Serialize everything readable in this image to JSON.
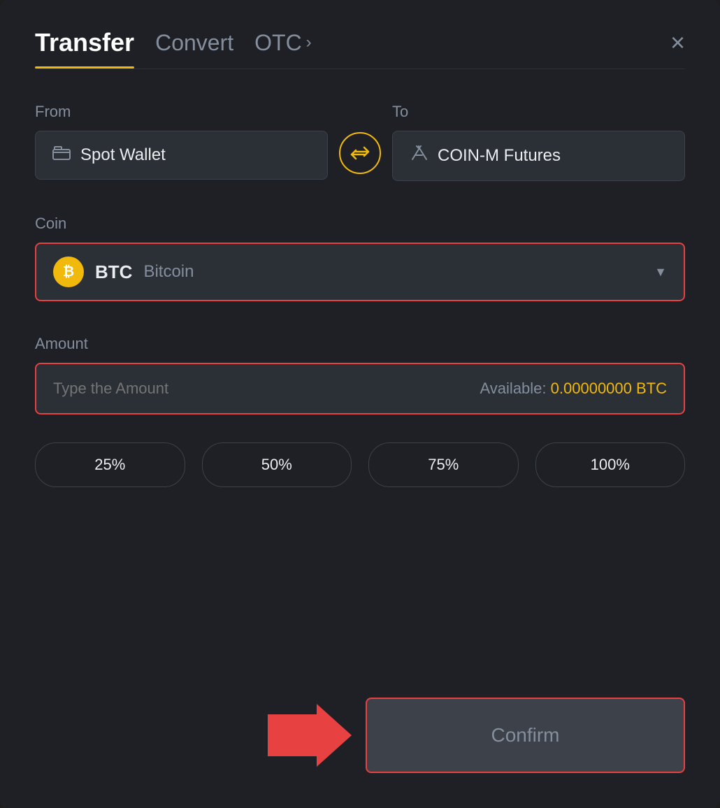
{
  "header": {
    "tab_transfer": "Transfer",
    "tab_convert": "Convert",
    "tab_otc": "OTC",
    "close_label": "×"
  },
  "from": {
    "label": "From",
    "wallet": "Spot Wallet"
  },
  "to": {
    "label": "To",
    "wallet": "COIN-M Futures"
  },
  "coin": {
    "label": "Coin",
    "symbol": "BTC",
    "name": "Bitcoin"
  },
  "amount": {
    "label": "Amount",
    "placeholder": "Type the Amount",
    "available_label": "Available:",
    "available_value": "0.00000000 BTC"
  },
  "percent_buttons": [
    "25%",
    "50%",
    "75%",
    "100%"
  ],
  "confirm_button": "Confirm"
}
